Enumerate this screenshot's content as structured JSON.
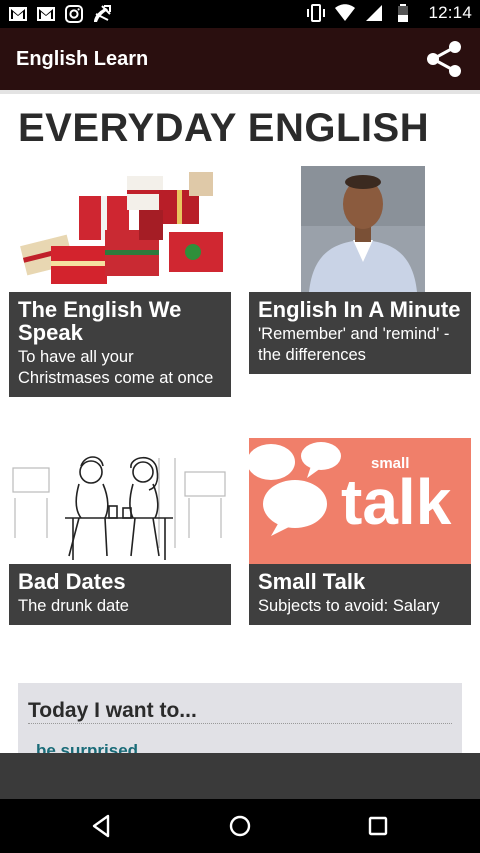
{
  "status_bar": {
    "left_icons": [
      "gmail-icon",
      "gmail-icon",
      "instagram-icon",
      "missed-call-icon"
    ],
    "right_icons": [
      "vibrate-icon",
      "wifi-icon",
      "signal-icon",
      "battery-icon"
    ],
    "time": "12:14"
  },
  "app_bar": {
    "title": "English Learn",
    "action_icon": "share-icon"
  },
  "section": {
    "title": "EVERYDAY ENGLISH"
  },
  "cards": [
    {
      "title": "The English We Speak",
      "subtitle": "To have all your Christmases come at once",
      "image": "christmas-presents"
    },
    {
      "title": "English In A Minute",
      "subtitle": "'Remember' and 'remind' - the differences",
      "image": "presenter"
    },
    {
      "title": "Bad Dates",
      "subtitle": "The drunk date",
      "image": "couple-sketch"
    },
    {
      "title": "Small Talk",
      "subtitle": "Subjects to avoid: Salary",
      "image": "small-talk-logo",
      "logo_small": "small",
      "logo_big": "talk"
    }
  ],
  "today": {
    "title": "Today I want to...",
    "option": "be surprised"
  },
  "nav_bar": {
    "buttons": [
      "back-icon",
      "home-icon",
      "recents-icon"
    ]
  },
  "colors": {
    "app_bar": "#2a0f0f",
    "caption_bg": "#3f3f3f",
    "today_bg": "#e1e1e6",
    "link": "#1a6b78",
    "small_talk_bg": "#f07f6a"
  }
}
